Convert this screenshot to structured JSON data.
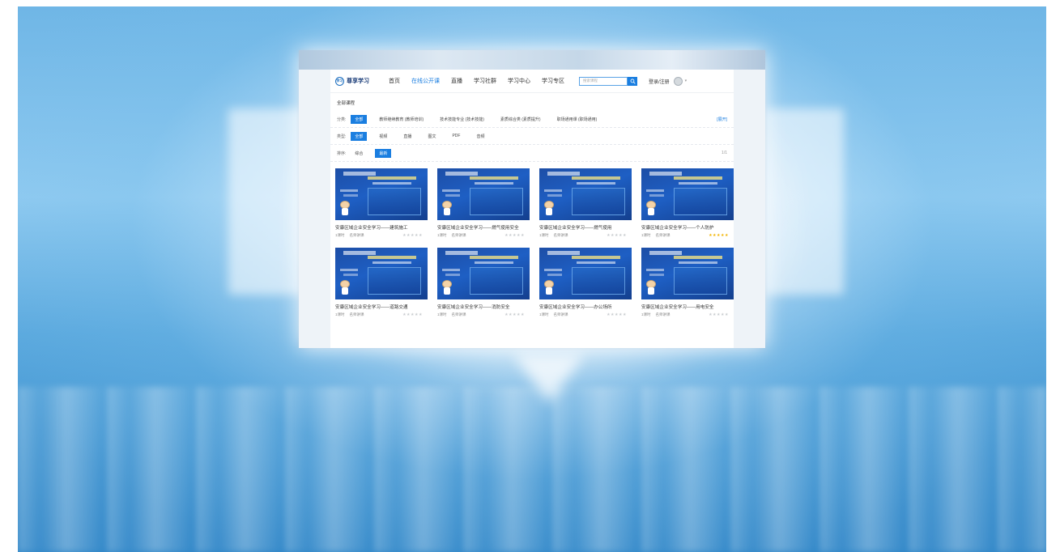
{
  "nav": {
    "logo_badge": "学习",
    "logo_text": "尊享学习",
    "items": [
      "首页",
      "在线公开课",
      "直播",
      "学习社群",
      "学习中心",
      "学习专区"
    ],
    "search_placeholder": "搜索课程",
    "login": "登录/注册"
  },
  "breadcrumb": "全部课程",
  "filters": {
    "category_label": "分类:",
    "category_items": [
      "全部",
      "教师继续教育 (教师培训)",
      "技术技能专业 (技术技能)",
      "素质综合类 (素质提升)",
      "职场通用课 (职场通用)"
    ],
    "category_more": "[展开]",
    "type_label": "类型:",
    "type_items": [
      "全部",
      "视频",
      "直播",
      "图文",
      "PDF",
      "音频"
    ],
    "sort_label": "排序:",
    "sort_items": [
      "综合",
      "最新"
    ],
    "sort_count": "1/1"
  },
  "courses": [
    {
      "title": "安康区域企业安全学习——建筑施工",
      "meta1": "1课时",
      "meta2": "名师讲课"
    },
    {
      "title": "安康区域企业安全学习——燃气使用安全",
      "meta1": "1课时",
      "meta2": "名师讲课"
    },
    {
      "title": "安康区域企业安全学习——燃气使用",
      "meta1": "1课时",
      "meta2": "名师讲课"
    },
    {
      "title": "安康区域企业安全学习——个人防护",
      "meta1": "1课时",
      "meta2": "名师讲课"
    },
    {
      "title": "安康区域企业安全学习——道路交通",
      "meta1": "1课时",
      "meta2": "名师讲课"
    },
    {
      "title": "安康区域企业安全学习——消防安全",
      "meta1": "1课时",
      "meta2": "名师讲课"
    },
    {
      "title": "安康区域企业安全学习——办公场所",
      "meta1": "1课时",
      "meta2": "名师讲课"
    },
    {
      "title": "安康区域企业安全学习——用电安全",
      "meta1": "1课时",
      "meta2": "名师讲课"
    }
  ],
  "colors": {
    "accent": "#1a7ee0",
    "thumb": "#1e5fc4",
    "star": "#f2b400"
  }
}
